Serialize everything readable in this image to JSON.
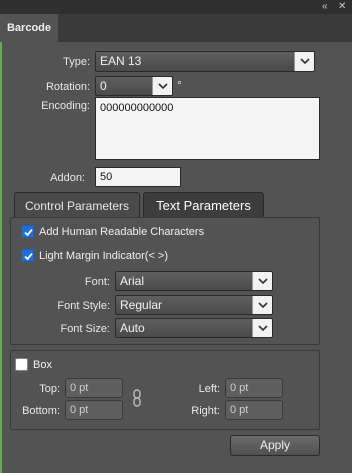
{
  "window": {
    "collapse_glyph": "«",
    "close_glyph": "✕",
    "tab_title": "Barcode"
  },
  "barcode": {
    "type_label": "Type:",
    "type_value": "EAN 13",
    "rotation_label": "Rotation:",
    "rotation_value": "0",
    "degree_symbol": "°",
    "encoding_label": "Encoding:",
    "encoding_value": "000000000000",
    "addon_label": "Addon:",
    "addon_value": "50"
  },
  "panel_tabs": [
    {
      "label": "Control Parameters",
      "active": false
    },
    {
      "label": "Text Parameters",
      "active": true
    }
  ],
  "text_params": {
    "human_readable": {
      "label": "Add Human Readable Characters",
      "checked": true
    },
    "light_margin": {
      "label": "Light Margin Indicator(< >)",
      "checked": true
    },
    "font_label": "Font:",
    "font_value": "Arial",
    "font_style_label": "Font Style:",
    "font_style_value": "Regular",
    "font_size_label": "Font Size:",
    "font_size_value": "Auto"
  },
  "box": {
    "label": "Box",
    "checked": false,
    "top_label": "Top:",
    "top_value": "0 pt",
    "bottom_label": "Bottom:",
    "bottom_value": "0 pt",
    "left_label": "Left:",
    "left_value": "0 pt",
    "right_label": "Right:",
    "right_value": "0 pt"
  },
  "apply_label": "Apply",
  "colors": {
    "panel_bg": "#535353",
    "accent_check": "#1f6fd6",
    "strip": "#6aa84f"
  },
  "icons": [
    "collapse-icon",
    "close-icon",
    "dropdown-arrow-icon",
    "checkmark-icon",
    "chain-link-icon"
  ]
}
